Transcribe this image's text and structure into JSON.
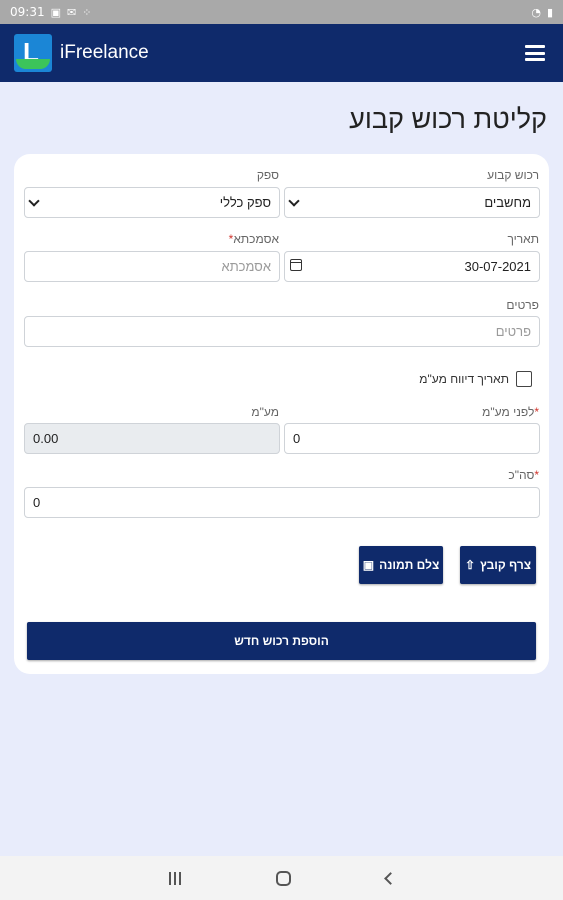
{
  "status_bar": {
    "time": "09:31",
    "icons": [
      "image-icon",
      "mail-icon",
      "grid-icon"
    ],
    "right_icons": [
      "wifi-icon",
      "battery-icon"
    ]
  },
  "app_bar": {
    "logo_letter": "L",
    "title": "iFreelance",
    "menu_icon": "hamburger-menu-icon"
  },
  "page": {
    "title": "קליטת רכוש קבוע"
  },
  "form": {
    "fixed_asset": {
      "label": "רכוש קבוע",
      "value": "מחשבים"
    },
    "supplier": {
      "label": "ספק",
      "value": "ספק כללי"
    },
    "date": {
      "label": "תאריך",
      "value": "30-07-2021"
    },
    "reference": {
      "label": "אסמכתא",
      "required_mark": "*",
      "placeholder": "אסמכתא"
    },
    "details": {
      "label": "פרטים",
      "placeholder": "פרטים"
    },
    "vat_report_date": {
      "label": "תאריך דיווח מע\"מ",
      "checked": false
    },
    "before_vat": {
      "label": "לפני מע\"מ",
      "required_mark": "*",
      "value": "0"
    },
    "vat": {
      "label": "מע\"מ",
      "value": "0.00"
    },
    "total": {
      "label": "סה\"כ",
      "required_mark": "*",
      "value": "0"
    }
  },
  "buttons": {
    "attach_file": "צרף קובץ",
    "take_photo": "צלם תמונה",
    "add_asset": "הוספת רכוש חדש"
  },
  "nav_bar": {
    "icons": [
      "recent-apps-icon",
      "home-icon",
      "back-icon"
    ]
  },
  "colors": {
    "primary": "#0f2a6b",
    "background": "#e8ecfb",
    "required": "#d0342c"
  }
}
